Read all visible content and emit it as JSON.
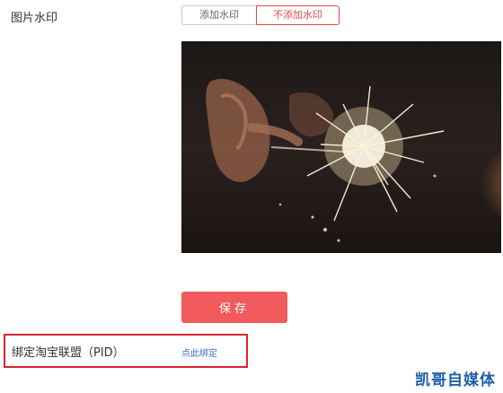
{
  "watermark": {
    "label": "图片水印",
    "options": [
      "添加水印",
      "不添加水印"
    ],
    "selected": "不添加水印"
  },
  "preview": {
    "alt": "sparkler photo"
  },
  "save": {
    "label": "保存"
  },
  "pid": {
    "label": "绑定淘宝联盟（PID）",
    "link": "点此绑定"
  },
  "brand": {
    "text": "凯哥自媒体"
  },
  "colors": {
    "accent": "#f15b5d",
    "selected_border": "#e4484d",
    "highlight_box": "#d9262b",
    "link": "#3b6fc3",
    "brand": "#1d5ea8"
  }
}
